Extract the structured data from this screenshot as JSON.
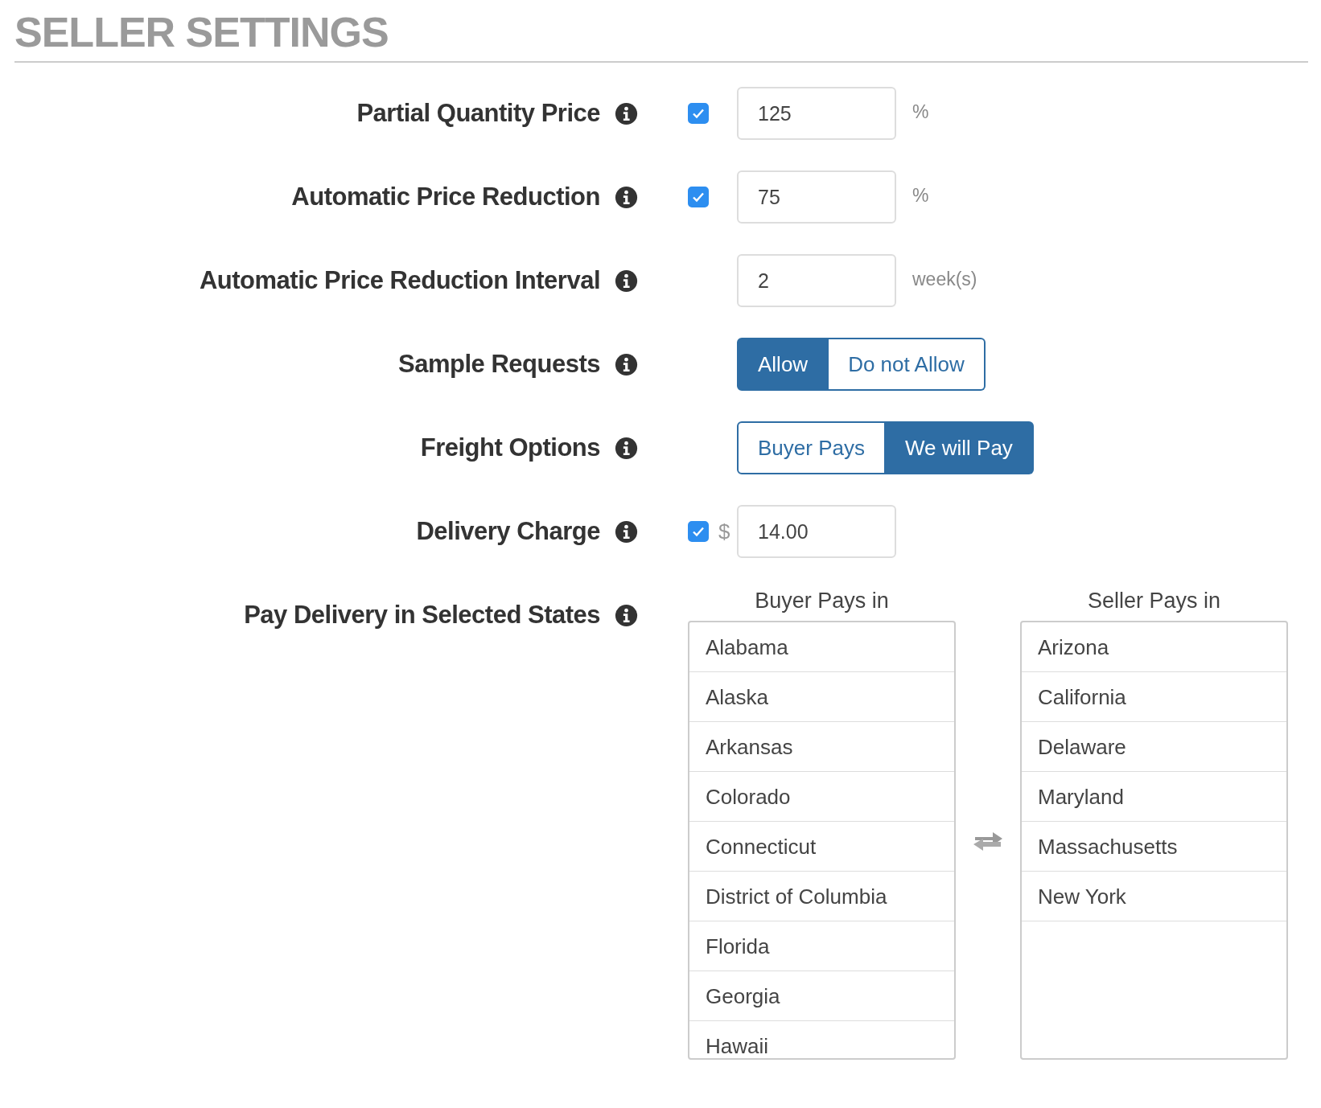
{
  "title": "SELLER SETTINGS",
  "settings": [
    {
      "kind": "input",
      "label": "Partial Quantity Price",
      "checked": true,
      "value": "125",
      "unit": "%"
    },
    {
      "kind": "input",
      "label": "Automatic Price Reduction",
      "checked": true,
      "value": "75",
      "unit": "%"
    },
    {
      "kind": "input",
      "label": "Automatic Price Reduction Interval",
      "value": "2",
      "unit": "week(s)"
    },
    {
      "kind": "toggle",
      "label": "Sample Requests",
      "options": [
        {
          "label": "Allow",
          "selected": true
        },
        {
          "label": "Do not Allow",
          "selected": false
        }
      ]
    },
    {
      "kind": "toggle",
      "label": "Freight Options",
      "options": [
        {
          "label": "Buyer Pays",
          "selected": false
        },
        {
          "label": "We will Pay",
          "selected": true
        }
      ]
    },
    {
      "kind": "input",
      "label": "Delivery Charge",
      "checked": true,
      "prefix": "$",
      "value": "14.00"
    },
    {
      "kind": "transfer",
      "label": "Pay Delivery in Selected States",
      "lists": [
        {
          "heading": "Buyer Pays in",
          "items": [
            "Alabama",
            "Alaska",
            "Arkansas",
            "Colorado",
            "Connecticut",
            "District of Columbia",
            "Florida",
            "Georgia",
            "Hawaii"
          ]
        },
        {
          "heading": "Seller Pays in",
          "items": [
            "Arizona",
            "California",
            "Delaware",
            "Maryland",
            "Massachusetts",
            "New York"
          ]
        }
      ]
    }
  ]
}
